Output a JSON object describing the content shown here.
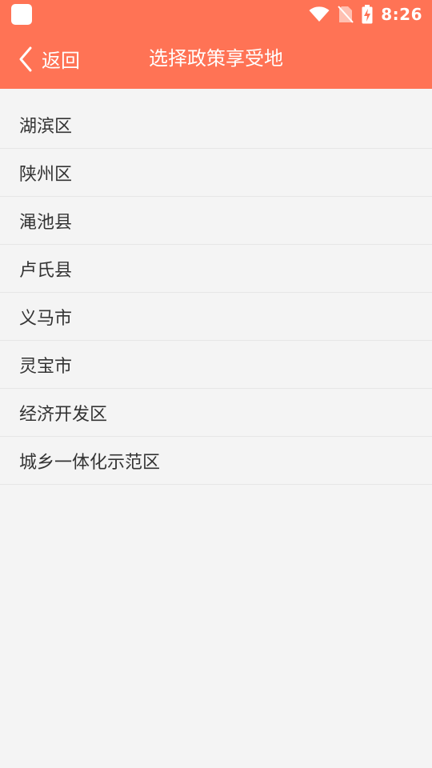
{
  "status_bar": {
    "time": "8:26",
    "icons": [
      "app-icon",
      "wifi-icon",
      "no-sim-icon",
      "battery-charging-icon"
    ]
  },
  "header": {
    "back_label": "返回",
    "title": "选择政策享受地",
    "back_icon": "chevron-left-icon"
  },
  "regions": [
    "湖滨区",
    "陕州区",
    "渑池县",
    "卢氏县",
    "义马市",
    "灵宝市",
    "经济开发区",
    "城乡一体化示范区"
  ],
  "colors": {
    "accent": "#ff7355",
    "background": "#f4f4f4",
    "text": "#333333",
    "divider": "#e6e6e6"
  }
}
